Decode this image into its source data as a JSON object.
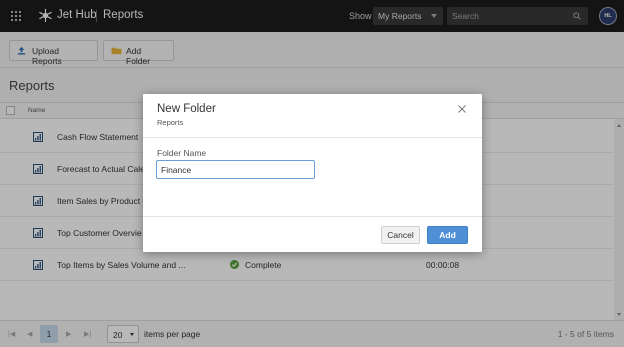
{
  "header": {
    "app_name": "Jet Hub",
    "page_name": "Reports",
    "show_label": "Show",
    "show_value": "My Reports",
    "search_placeholder": "Search",
    "avatar_initials": "HL"
  },
  "toolbar": {
    "upload_label": "Upload Reports",
    "add_folder_label": "Add Folder"
  },
  "section": {
    "title": "Reports"
  },
  "grid": {
    "columns": {
      "name": "Name"
    },
    "rows": [
      {
        "name": "Cash Flow Statement",
        "status": "",
        "duration": ""
      },
      {
        "name": "Forecast to Actual Cale",
        "status": "",
        "duration": ""
      },
      {
        "name": "Item Sales by Product C",
        "status": "",
        "duration": ""
      },
      {
        "name": "Top Customer Overvie",
        "status": "",
        "duration": ""
      },
      {
        "name": "Top Items by Sales Volume and ...",
        "status": "Complete",
        "duration": "00:00:08"
      }
    ]
  },
  "pager": {
    "first": "|◀",
    "prev": "◀",
    "page": "1",
    "next": "▶",
    "last": "▶|",
    "page_size": "20",
    "page_size_label": "items per page",
    "info": "1 - 5 of 5 items"
  },
  "modal": {
    "title": "New Folder",
    "subtitle": "Reports",
    "field_label": "Folder Name",
    "field_value": "Finance",
    "cancel_label": "Cancel",
    "add_label": "Add"
  },
  "colors": {
    "topbar": "#1c1c1c",
    "primary": "#4e8fd6",
    "success": "#5aa33e",
    "folder": "#e8b33a"
  }
}
